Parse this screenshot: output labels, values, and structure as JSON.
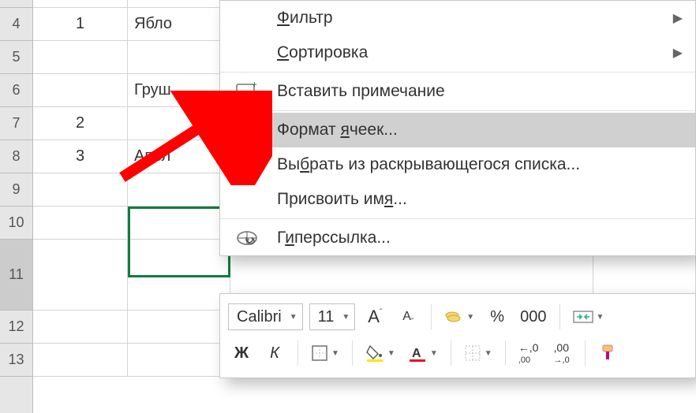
{
  "grid": {
    "row_labels": [
      "4",
      "5",
      "6",
      "7",
      "8",
      "9",
      "10",
      "11",
      "12",
      "13"
    ],
    "cells": {
      "A4": "1",
      "A7": "2",
      "A8": "3",
      "B4": "Ябло",
      "B6": "Груш",
      "B8": "Апел"
    }
  },
  "menu": {
    "filter": "Фильтр",
    "sort": "Сортировка",
    "comment": "Вставить примечание",
    "format": "Формат ячеек...",
    "dropdown": "Выбрать из раскрывающегося списка...",
    "name": "Присвоить имя...",
    "hyperlink": "Гиперссылка..."
  },
  "toolbar": {
    "font_name": "Calibri",
    "font_size": "11",
    "bold": "Ж",
    "italic": "К",
    "percent": "%",
    "thousands": "000",
    "inc_dec": ",0",
    "dec_dec": ",00"
  }
}
